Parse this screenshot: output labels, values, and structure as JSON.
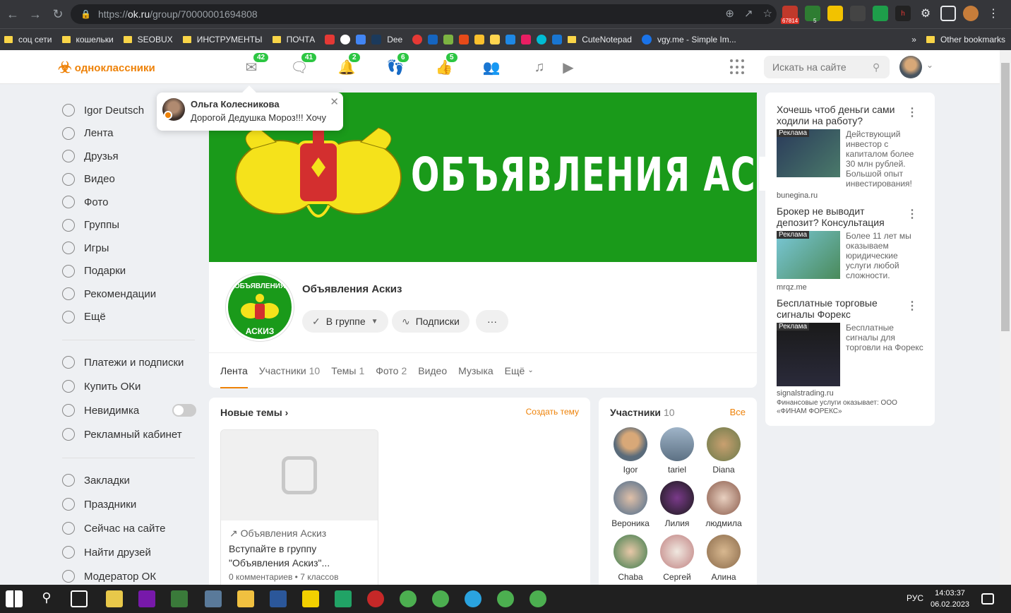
{
  "browser": {
    "url_base": "https://",
    "url_host": "ok.ru",
    "url_path": "/group/70000001694808",
    "ext_badge": "67814",
    "ext_badge2": "5",
    "bookmarks": [
      "соц сети",
      "кошельки",
      "SEOBUX",
      "ИНСТРУМЕНТЫ",
      "ПОЧТА",
      "Dee",
      "CuteNotepad",
      "vgy.me - Simple Im..."
    ],
    "other_bookmarks": "Other bookmarks"
  },
  "header": {
    "logo": "одноклассники",
    "badges": {
      "messages": "42",
      "discussions": "41",
      "notifications": "2",
      "guests": "6",
      "marks": "5"
    },
    "search_placeholder": "Искать на сайте"
  },
  "left_nav": {
    "primary": [
      "Igor Deutsch",
      "Лента",
      "Друзья",
      "Видео",
      "Фото",
      "Группы",
      "Игры",
      "Подарки",
      "Рекомендации",
      "Ещё"
    ],
    "secondary": [
      "Платежи и подписки",
      "Купить ОКи",
      "Невидимка",
      "Рекламный кабинет"
    ],
    "tertiary": [
      "Закладки",
      "Праздники",
      "Сейчас на сайте",
      "Найти друзей",
      "Модератор ОК"
    ]
  },
  "notification": {
    "name": "Ольга Колесникова",
    "text": "Дорогой Дедушка Мороз!!! Хочу"
  },
  "group": {
    "cover_title": "ОБЪЯВЛЕНИЯ АСКИЗ",
    "logo_top": "ОБЪЯВЛЕНИЯ",
    "logo_bottom": "АСКИЗ",
    "name": "Объявления Аскиз",
    "btn_joined": "В группе",
    "btn_subs": "Подписки",
    "btn_more": "···",
    "tabs": [
      {
        "label": "Лента",
        "count": ""
      },
      {
        "label": "Участники",
        "count": "10"
      },
      {
        "label": "Темы",
        "count": "1"
      },
      {
        "label": "Фото",
        "count": "2"
      },
      {
        "label": "Видео",
        "count": ""
      },
      {
        "label": "Музыка",
        "count": ""
      },
      {
        "label": "Ещё",
        "count": ""
      }
    ]
  },
  "topics": {
    "title": "Новые темы",
    "create": "Создать тему",
    "card": {
      "source": "Объявления Аскиз",
      "text": "Вступайте в группу \"Объявления Аскиз\"...",
      "meta": "0 комментариев • 7 классов"
    }
  },
  "members": {
    "title": "Участники",
    "count": "10",
    "all": "Все",
    "list": [
      "Igor",
      "tariel",
      "Diana",
      "Вероника",
      "Лилия",
      "людмила",
      "Chaba",
      "Сергей",
      "Алина"
    ]
  },
  "ads": [
    {
      "title": "Хочешь чтоб деньги сами ходили на работу?",
      "label": "Реклама",
      "desc": "Действующий инвестор с капиталом более 30 млн рублей. Большой опыт инвестирования!",
      "domain": "bunegina.ru"
    },
    {
      "title": "Брокер не выводит депозит? Консультация юриста.",
      "label": "Реклама",
      "desc": "Более 11 лет мы оказываем юридические услуги любой сложности.",
      "domain": "mrqz.me"
    },
    {
      "title": "Бесплатные торговые сигналы Форекс",
      "label": "Реклама",
      "desc": "Бесплатные сигналы для торговли на Форекс",
      "domain": "signalstrading.ru"
    }
  ],
  "ad_legal": "Финансовые услуги оказывает: ООО «ФИНАМ ФОРЕКС»",
  "taskbar": {
    "lang": "РУС",
    "time": "14:03:37",
    "date": "06.02.2023"
  }
}
